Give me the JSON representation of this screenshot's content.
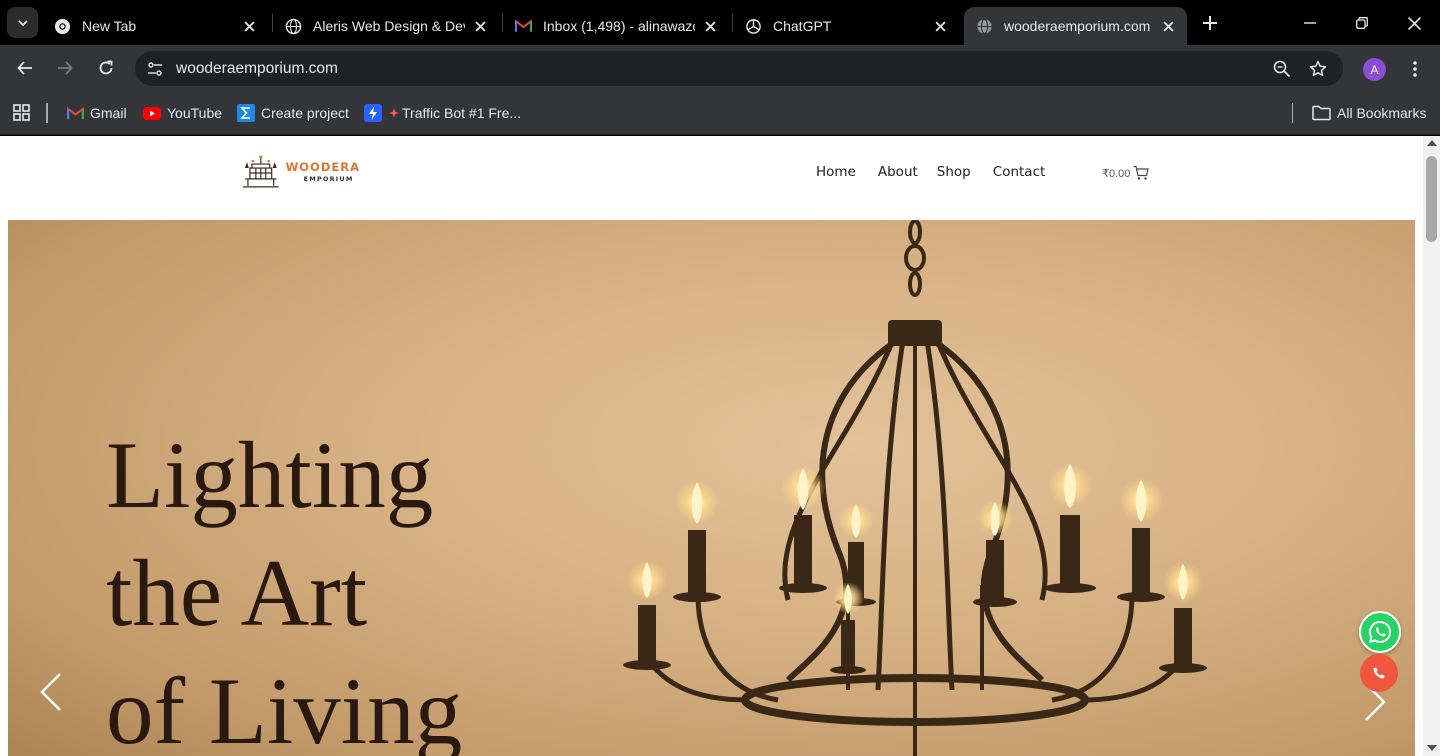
{
  "tabs": [
    {
      "title": "New Tab",
      "icon": "chrome-icon"
    },
    {
      "title": "Aleris Web Design & Dev",
      "icon": "globe-icon"
    },
    {
      "title": "Inbox (1,498) - alinawazo",
      "icon": "gmail-icon"
    },
    {
      "title": "ChatGPT",
      "icon": "openai-icon"
    },
    {
      "title": "wooderaemporium.com",
      "icon": "globe-icon",
      "active": true
    }
  ],
  "toolbar": {
    "url": "wooderaemporium.com",
    "avatar_letter": "A"
  },
  "bookmarks": {
    "items": [
      {
        "label": "Gmail",
        "icon": "gmail-icon"
      },
      {
        "label": "YouTube",
        "icon": "youtube-icon"
      },
      {
        "label": "Create project",
        "icon": "sigma-icon"
      },
      {
        "label": "Traffic Bot #1 Fre...",
        "icon": "bolt-icon"
      }
    ],
    "all_label": "All Bookmarks"
  },
  "site": {
    "logo_main": "WOODERA",
    "logo_sub": "EMPORIUM",
    "nav": [
      "Home",
      "About",
      "Shop",
      "Contact"
    ],
    "cart_total": "₹0.00",
    "hero_lines": [
      "Lighting",
      "the Art",
      "of Living"
    ]
  },
  "colors": {
    "brand_orange": "#e0752d",
    "hero_text": "#2a1910",
    "whatsapp": "#25d366",
    "call": "#f0553d"
  }
}
